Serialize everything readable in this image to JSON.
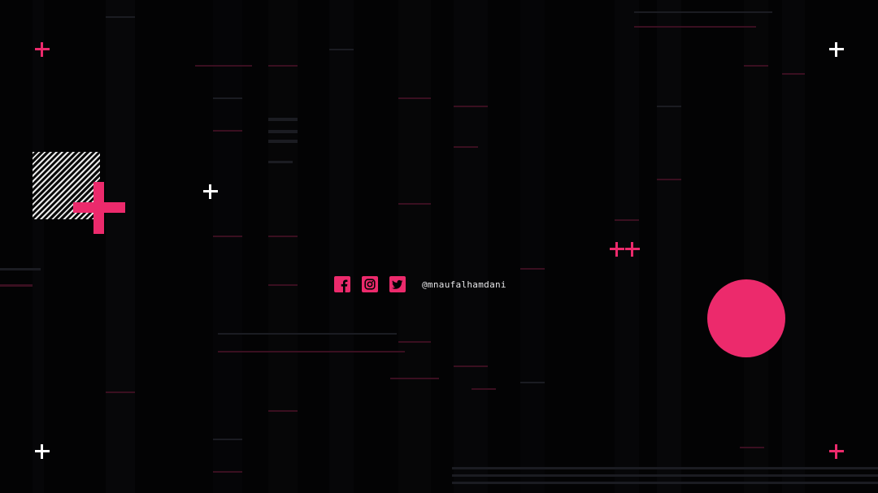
{
  "colors": {
    "background": "#030304",
    "accent": "#ec2a6c",
    "white": "#ffffff"
  },
  "social": {
    "handle": "@mnaufalhamdani",
    "icons": [
      "facebook-icon",
      "instagram-icon",
      "twitter-icon"
    ]
  }
}
